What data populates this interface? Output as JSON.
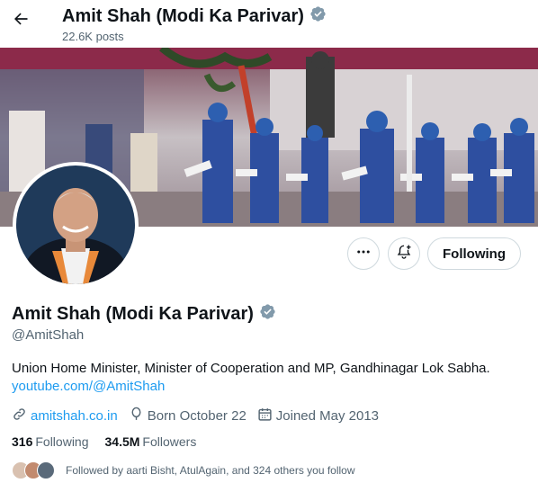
{
  "header": {
    "title": "Amit Shah (Modi Ka Parivar)",
    "posts_count": "22.6K posts",
    "back_icon": "arrow-left-icon"
  },
  "profile": {
    "display_name": "Amit Shah (Modi Ka Parivar)",
    "handle": "@AmitShah",
    "verified_color": "#829aab",
    "bio": "Union Home Minister, Minister of Cooperation and MP, Gandhinagar Lok Sabha.",
    "bio_link": "youtube.com/@AmitShah",
    "website": "amitshah.co.in",
    "born": "Born October 22",
    "joined": "Joined May 2013"
  },
  "actions": {
    "more_icon": "more-horizontal-icon",
    "notify_icon": "bell-plus-icon",
    "following_label": "Following"
  },
  "stats": {
    "following_count": "316",
    "following_label": "Following",
    "followers_count": "34.5M",
    "followers_label": "Followers"
  },
  "followed_by": {
    "text": "Followed by aarti Bisht, AtulAgain, and 324 others you follow"
  },
  "colors": {
    "accent": "#1d9bf0",
    "secondary_text": "#536471",
    "border": "#cfd9de"
  }
}
